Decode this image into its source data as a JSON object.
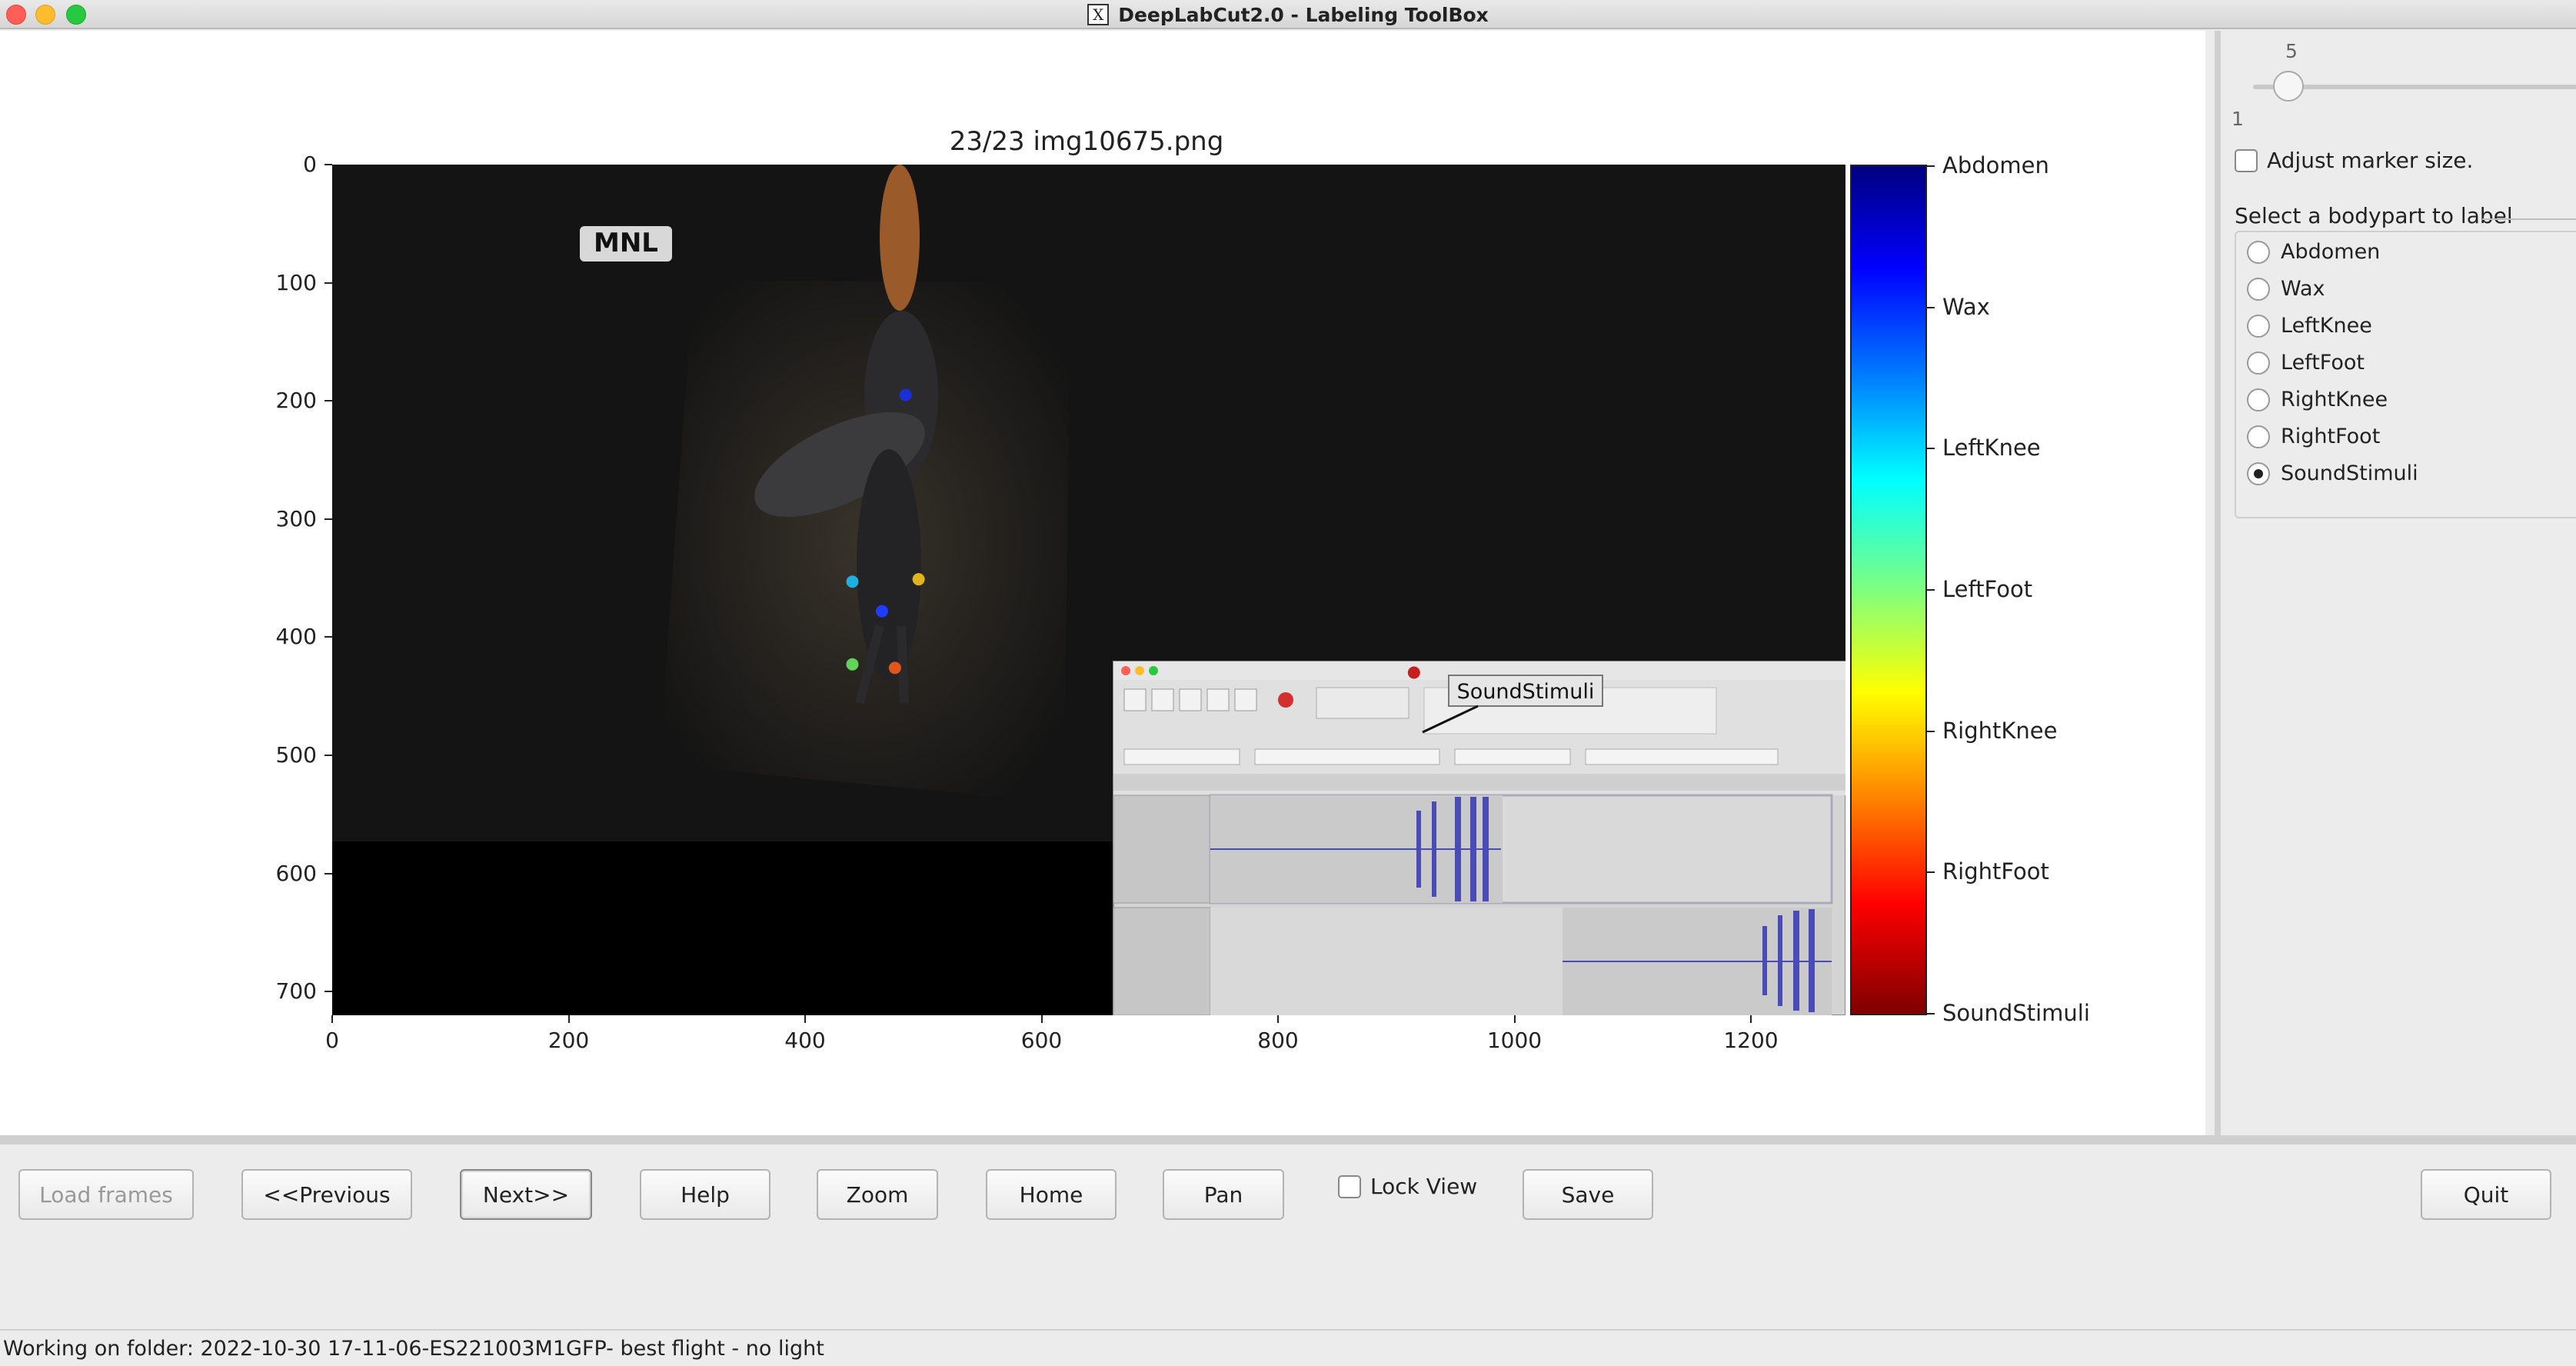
{
  "window": {
    "title": "DeepLabCut2.0 - Labeling ToolBox",
    "title_icon": "X"
  },
  "figure": {
    "title": "23/23 img10675.png",
    "stamp": "MNL",
    "y_ticks": [
      "0",
      "100",
      "200",
      "300",
      "400",
      "500",
      "600",
      "700"
    ],
    "x_ticks": [
      "0",
      "200",
      "400",
      "600",
      "800",
      "1000",
      "1200"
    ],
    "marker_tooltip": "SoundStimuli"
  },
  "chart_data": {
    "type": "scatter",
    "title": "23/23 img10675.png",
    "xlim": [
      0,
      1280
    ],
    "ylim": [
      720,
      0
    ],
    "points": [
      {
        "label": "Abdomen",
        "x": 485,
        "y": 195,
        "color": "#1a2fd6"
      },
      {
        "label": "Wax",
        "x": 465,
        "y": 378,
        "color": "#1f3cff"
      },
      {
        "label": "LeftKnee",
        "x": 440,
        "y": 353,
        "color": "#1eaee0"
      },
      {
        "label": "LeftFoot",
        "x": 440,
        "y": 423,
        "color": "#63d25a"
      },
      {
        "label": "RightKnee",
        "x": 496,
        "y": 351,
        "color": "#e0b41a"
      },
      {
        "label": "RightFoot",
        "x": 476,
        "y": 426,
        "color": "#e0561a"
      },
      {
        "label": "SoundStimuli",
        "x": 915,
        "y": 430,
        "color": "#c81e1e"
      }
    ],
    "colorbar": [
      "Abdomen",
      "Wax",
      "LeftKnee",
      "LeftFoot",
      "RightKnee",
      "RightFoot",
      "SoundStimuli"
    ]
  },
  "panel": {
    "slider_max": "5",
    "slider_min": "1",
    "adjust_label": "Adjust marker size.",
    "group_title": "Select a bodypart to label",
    "bodyparts": [
      "Abdomen",
      "Wax",
      "LeftKnee",
      "LeftFoot",
      "RightKnee",
      "RightFoot",
      "SoundStimuli"
    ],
    "selected": "SoundStimuli"
  },
  "toolbar": {
    "load": "Load frames",
    "previous": "<<Previous",
    "next": "Next>>",
    "help": "Help",
    "zoom": "Zoom",
    "home": "Home",
    "pan": "Pan",
    "lock": "Lock View",
    "save": "Save",
    "quit": "Quit"
  },
  "status": "Working on folder: 2022-10-30 17-11-06-ES221003M1GFP- best flight - no light"
}
